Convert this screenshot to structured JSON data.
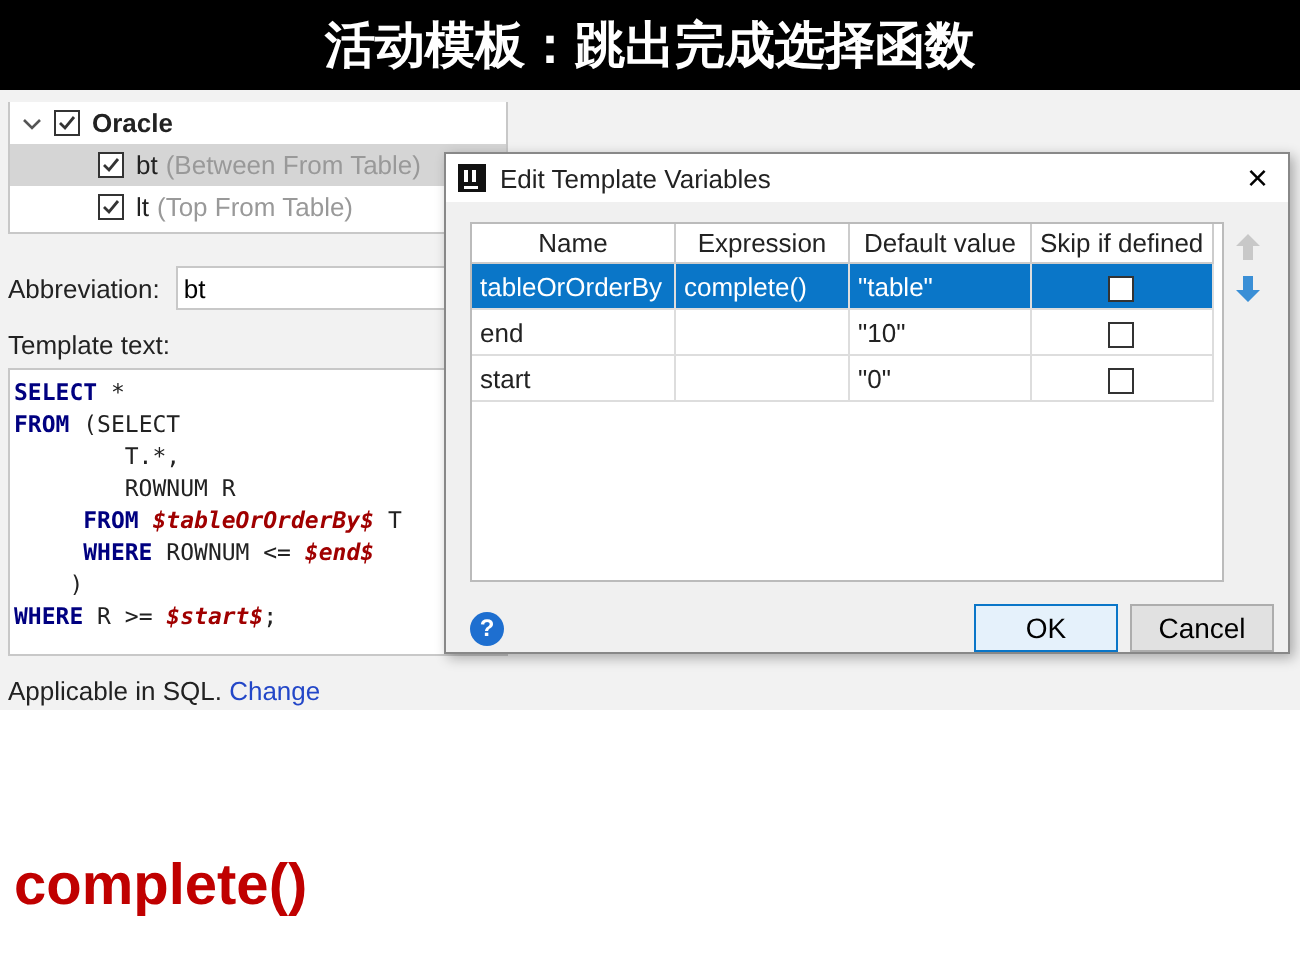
{
  "slide_title": "活动模板：跳出完成选择函数",
  "template_tree": {
    "group": {
      "label": "Oracle",
      "expanded": true,
      "checked": true,
      "children": [
        {
          "abbreviation": "bt",
          "description": "(Between From Table)",
          "checked": true,
          "selected": true
        },
        {
          "abbreviation": "lt",
          "description": "(Top From Table)",
          "checked": true,
          "selected": false
        }
      ]
    }
  },
  "abbreviation": {
    "label": "Abbreviation:",
    "value": "bt"
  },
  "template_text": {
    "label": "Template text:",
    "lines": [
      [
        {
          "kind": "keyword",
          "text": "SELECT"
        },
        {
          "kind": "plain",
          "text": " *"
        }
      ],
      [
        {
          "kind": "keyword",
          "text": "FROM"
        },
        {
          "kind": "plain",
          "text": " (SELECT"
        }
      ],
      [
        {
          "kind": "plain",
          "text": "        T.*,"
        }
      ],
      [
        {
          "kind": "plain",
          "text": "        ROWNUM R"
        }
      ],
      [
        {
          "kind": "keyword",
          "text": "     FROM "
        },
        {
          "kind": "variable",
          "text": "$tableOrOrderBy$"
        },
        {
          "kind": "plain",
          "text": " T"
        }
      ],
      [
        {
          "kind": "keyword",
          "text": "     WHERE"
        },
        {
          "kind": "plain",
          "text": " ROWNUM <= "
        },
        {
          "kind": "variable",
          "text": "$end$"
        }
      ],
      [
        {
          "kind": "plain",
          "text": "    )"
        }
      ],
      [
        {
          "kind": "keyword",
          "text": "WHERE"
        },
        {
          "kind": "plain",
          "text": " R >= "
        },
        {
          "kind": "variable",
          "text": "$start$"
        },
        {
          "kind": "plain",
          "text": ";"
        }
      ]
    ]
  },
  "applicable": {
    "text": "Applicable in SQL.",
    "link": "Change"
  },
  "dialog": {
    "title": "Edit Template Variables",
    "close": "×",
    "columns": [
      "Name",
      "Expression",
      "Default value",
      "Skip if defined"
    ],
    "rows": [
      {
        "name": "tableOrOrderBy",
        "expression": "complete()",
        "default_value": "\"table\"",
        "skip_if_defined": false,
        "selected": true
      },
      {
        "name": "end",
        "expression": "",
        "default_value": "\"10\"",
        "skip_if_defined": false,
        "selected": false
      },
      {
        "name": "start",
        "expression": "",
        "default_value": "\"0\"",
        "skip_if_defined": false,
        "selected": false
      }
    ],
    "move_up": {
      "disabled": true
    },
    "move_down": {
      "disabled": false
    },
    "help": "?",
    "buttons": [
      {
        "label": "OK",
        "default": true
      },
      {
        "label": "Cancel",
        "default": false
      }
    ]
  },
  "caption": "complete()"
}
